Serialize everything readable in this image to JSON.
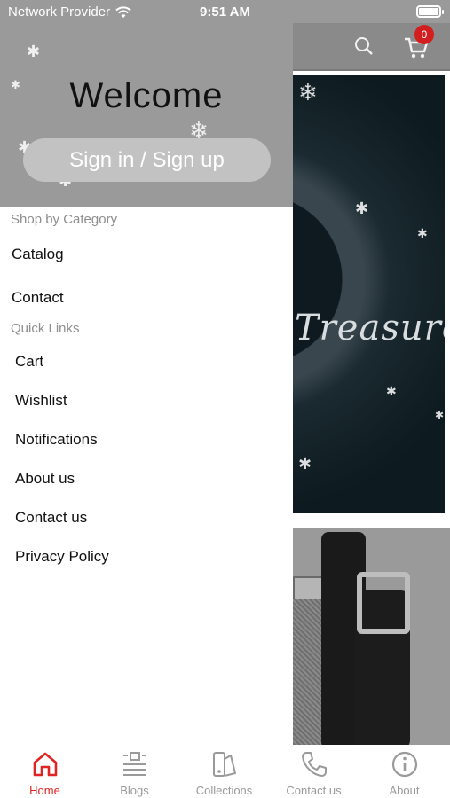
{
  "status_bar": {
    "carrier": "Network Provider",
    "time": "9:51 AM"
  },
  "background_app": {
    "cart_count": "0",
    "banner_text": "Treasure"
  },
  "drawer": {
    "welcome": "Welcome",
    "sign_in_label": "Sign in / Sign up",
    "shop_by_category_label": "Shop by Category",
    "category_items": [
      {
        "label": "Catalog"
      },
      {
        "label": "Contact"
      }
    ],
    "quick_links_label": "Quick Links",
    "quick_links": [
      {
        "label": "Cart"
      },
      {
        "label": "Wishlist"
      },
      {
        "label": "Notifications"
      },
      {
        "label": "About us"
      },
      {
        "label": "Contact us"
      },
      {
        "label": "Privacy Policy"
      }
    ]
  },
  "tab_bar": {
    "tabs": [
      {
        "label": "Home",
        "icon": "home-icon",
        "active": true
      },
      {
        "label": "Blogs",
        "icon": "blogs-icon"
      },
      {
        "label": "Collections",
        "icon": "collections-icon"
      },
      {
        "label": "Contact us",
        "icon": "phone-icon"
      },
      {
        "label": "About",
        "icon": "info-icon"
      }
    ]
  },
  "colors": {
    "accent": "#e02424",
    "header_gray": "#9a9a9a",
    "badge": "#d21e1e"
  }
}
